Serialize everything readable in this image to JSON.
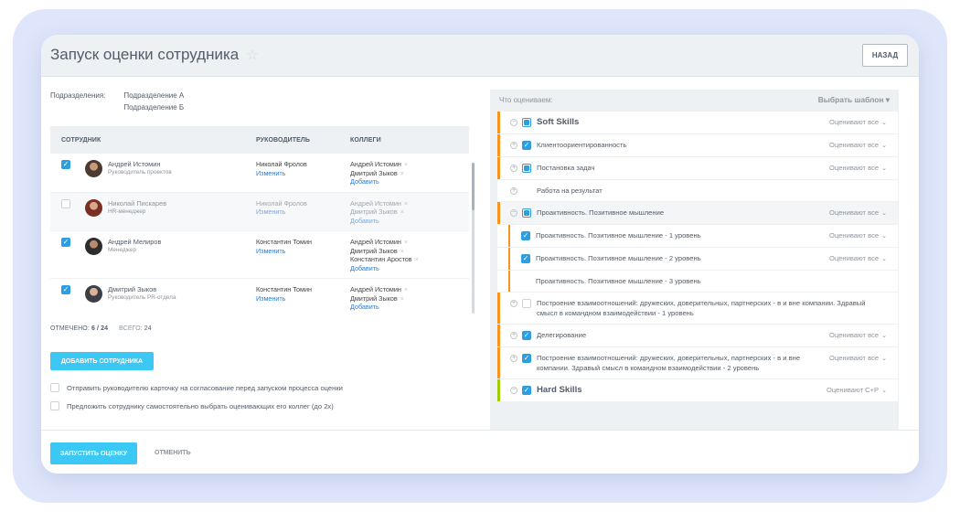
{
  "page": {
    "title": "Запуск оценки сотрудника",
    "back_label": "НАЗАД"
  },
  "departments": {
    "label": "Подразделения:",
    "values": [
      "Подразделение А",
      "Подразделение Б"
    ]
  },
  "table": {
    "headers": {
      "employee": "СОТРУДНИК",
      "manager": "РУКОВОДИТЕЛЬ",
      "colleagues": "КОЛЛЕГИ"
    },
    "rows": [
      {
        "checked": true,
        "name": "Андрей Истомин",
        "role": "Руководитель проектов",
        "manager": "Николай Фролов",
        "change": "Изменить",
        "colleagues": [
          "Андрей Истомин",
          "Дмитрий Зыков"
        ],
        "add": "Добавить"
      },
      {
        "checked": false,
        "name": "Николай Пискарев",
        "role": "HR-менеджер",
        "manager": "Николай Фролов",
        "change": "Изменить",
        "colleagues": [
          "Андрей Истомин",
          "Дмитрий Зыков"
        ],
        "add": "Добавить"
      },
      {
        "checked": true,
        "name": "Андрей Мелиров",
        "role": "Менеджер",
        "manager": "Константин Томин",
        "change": "Изменить",
        "colleagues": [
          "Андрей Истомин",
          "Дмитрий Зыков",
          "Константин Аростов"
        ],
        "add": "Добавить"
      },
      {
        "checked": true,
        "name": "Дмитрий Зыков",
        "role": "Руководитель PR-отдела",
        "manager": "Константин Томин",
        "change": "Изменить",
        "colleagues": [
          "Андрей Истомин",
          "Дмитрий Зыков"
        ],
        "add": "Добавить"
      }
    ]
  },
  "counts": {
    "checked_label": "ОТМЕЧЕНО:",
    "checked_value": "6 / 24",
    "total_label": "ВСЕГО:",
    "total_value": "24"
  },
  "add_employee_label": "ДОБАВИТЬ СОТРУДНИКА",
  "options": [
    "Отправить руководителю карточку на согласование перед запуском процесса оценки",
    "Предложить сотруднику самостоятельно выбрать оценивающих его коллег (до 2х)"
  ],
  "assess": {
    "header_label": "Что оцениваем:",
    "template_label": "Выбрать шаблон",
    "items": [
      {
        "level": 0,
        "toggle": "−",
        "check": "partial",
        "label": "Soft Skills",
        "who": "Оценивают все",
        "bar": "orange",
        "big": true,
        "hl": false
      },
      {
        "level": 0,
        "toggle": "+",
        "check": "on",
        "label": "Клиентоориентированность",
        "who": "Оценивают все",
        "bar": "orange",
        "big": false,
        "hl": false
      },
      {
        "level": 0,
        "toggle": "+",
        "check": "partial",
        "label": "Постановка задач",
        "who": "Оценивают все",
        "bar": "orange",
        "big": false,
        "hl": false
      },
      {
        "level": 0,
        "toggle": "+",
        "check": "none",
        "label": "Работа на результат",
        "who": "",
        "bar": "none",
        "big": false,
        "hl": false
      },
      {
        "level": 0,
        "toggle": "−",
        "check": "partial",
        "label": "Проактивность. Позитивное мышление",
        "who": "Оценивают все",
        "bar": "orange",
        "big": false,
        "hl": true
      },
      {
        "level": 1,
        "toggle": "",
        "check": "on",
        "label": "Проактивность. Позитивное мышление - 1 уровень",
        "who": "Оценивают все",
        "bar": "orange",
        "big": false,
        "hl": false
      },
      {
        "level": 1,
        "toggle": "",
        "check": "on",
        "label": "Проактивность. Позитивное мышление - 2 уровень",
        "who": "Оценивают все",
        "bar": "orange",
        "big": false,
        "hl": false
      },
      {
        "level": 1,
        "toggle": "",
        "check": "none",
        "label": "Проактивность. Позитивное мышление - 3 уровень",
        "who": "",
        "bar": "orange",
        "big": false,
        "hl": false
      },
      {
        "level": 0,
        "toggle": "+",
        "check": "off",
        "label": "Построение взаимоотношений: дружеских, доверительных, партнерских - в и вне компании. Здравый смысл в командном взаимодействии - 1 уровень",
        "who": "",
        "bar": "orange",
        "big": false,
        "hl": false
      },
      {
        "level": 0,
        "toggle": "+",
        "check": "on",
        "label": "Делегирование",
        "who": "Оценивают все",
        "bar": "orange",
        "big": false,
        "hl": false
      },
      {
        "level": 0,
        "toggle": "+",
        "check": "on",
        "label": "Построение взаимоотношений: дружеских, доверительных, партнерских - в и вне компании. Здравый смысл в командном взаимодействии - 2 уровень",
        "who": "Оценивают все",
        "bar": "orange",
        "big": false,
        "hl": false
      },
      {
        "level": 0,
        "toggle": "−",
        "check": "on",
        "label": "Hard Skills",
        "who": "Оценивают С+Р",
        "bar": "green",
        "big": true,
        "hl": false
      }
    ]
  },
  "footer": {
    "run_label": "ЗАПУСТИТЬ ОЦЕНКУ",
    "cancel_label": "ОТМЕНИТЬ"
  },
  "colors": {
    "accent": "#3bc8f5",
    "checkbox": "#2d9ee0",
    "link": "#2d7bd1",
    "bar_orange": "#f7941d",
    "bar_green": "#9dcf00"
  }
}
